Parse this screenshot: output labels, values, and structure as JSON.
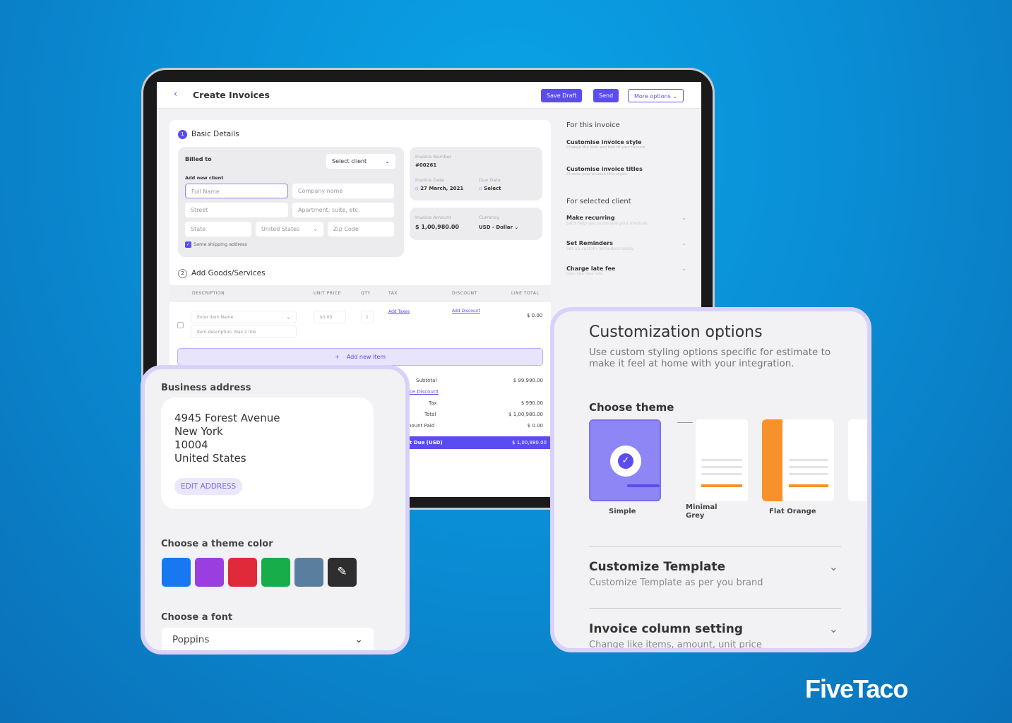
{
  "app": {
    "title": "Create Invoices",
    "save_draft": "Save Draft",
    "send": "Send",
    "more_options": "More options"
  },
  "basic": {
    "step": "1",
    "title": "Basic Details",
    "billed_to": "Billed to",
    "select_client": "Select client",
    "add_new_client": "Add new client",
    "fields": {
      "full_name": "Full Name",
      "company": "Company name",
      "street": "Street",
      "apartment": "Apartment, suite, etc.",
      "state": "State",
      "country": "United States",
      "zip": "Zip Code"
    },
    "same_shipping": "Same shipping address",
    "invoice_number_label": "Invoice Number",
    "invoice_number": "#00261",
    "invoice_date_label": "Invoice Date",
    "invoice_date": "27 March, 2021",
    "due_date_label": "Due Date",
    "due_date": "Select",
    "invoice_amount_label": "Invoice Amount",
    "invoice_amount": "$ 1,00,980.00",
    "currency_label": "Currency",
    "currency": "USD - Dollar"
  },
  "goods": {
    "step": "2",
    "title": "Add Goods/Services",
    "columns": [
      "DESCRIPTION",
      "UNIT PRICE",
      "QTY",
      "TAX",
      "DISCOUNT",
      "LINE TOTAL"
    ],
    "item_placeholder": "Enter Item Name",
    "desc_placeholder": "Item description. Max 2 line",
    "price_placeholder": "$0.00",
    "qty": "1",
    "add_taxes": "Add Taxes",
    "add_discount": "Add Discount",
    "line_total": "$ 0.00",
    "add_item": "Add new item"
  },
  "totals": {
    "subtotal_label": "Subtotal",
    "subtotal": "$ 99,990.00",
    "discount_link": "ice Discount",
    "tax_label": "Tax",
    "tax": "$ 990.00",
    "total_label": "Total",
    "total": "$ 1,00,980.00",
    "paid_label": "nount Paid",
    "paid": "$ 0.00",
    "due_label": "t Due (USD)",
    "due": "$ 1,00,980.00"
  },
  "sidebar": {
    "for_invoice": "For this invoice",
    "items_invoice": [
      {
        "title": "Customise invoice style",
        "sub": "Change the look and feel of your invoice"
      },
      {
        "title": "Customise invoice titles",
        "sub": "Choose your invoice title styles."
      }
    ],
    "for_client": "For selected client",
    "items_client": [
      {
        "title": "Make recurring",
        "sub": "Let's help you automate your invoices."
      },
      {
        "title": "Set Reminders",
        "sub": "Set up custom reminders easily."
      },
      {
        "title": "Charge late fee",
        "sub": "Levy late fees rate."
      }
    ]
  },
  "business": {
    "title": "Business address",
    "address": [
      "4945  Forest Avenue",
      "New York",
      "10004",
      "United States"
    ],
    "edit": "EDIT ADDRESS",
    "theme_color_title": "Choose a theme color",
    "colors": [
      "#1778f2",
      "#9b3ee0",
      "#e02a3a",
      "#16ad4a",
      "#5a7f9e",
      "#2e2e2e"
    ],
    "font_title": "Choose a font",
    "font": "Poppins"
  },
  "custom": {
    "title": "Customization options",
    "subtitle": "Use custom styling options specific for estimate to make it feel at home with your integration.",
    "theme_title": "Choose theme",
    "themes": [
      {
        "name": "Simple",
        "selected": true
      },
      {
        "name": "Minimal Grey",
        "selected": false
      },
      {
        "name": "Flat Orange",
        "selected": false
      }
    ],
    "template_title": "Customize Template",
    "template_sub": "Customize Template as per you brand",
    "column_title": "Invoice column setting",
    "column_sub": "Change like items, amount, unit price"
  },
  "brand": {
    "logo": "FiveTaco"
  },
  "accent": "#5b4cf0"
}
